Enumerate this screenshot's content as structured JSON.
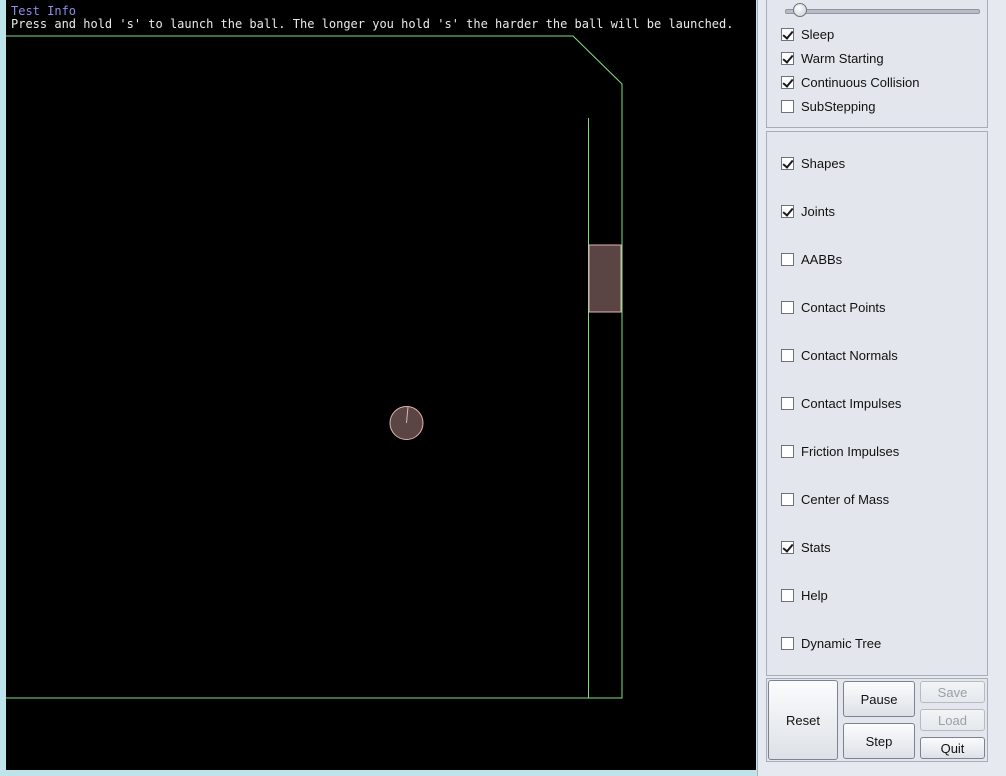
{
  "info": {
    "title": "Test Info",
    "text": "Press and hold 's' to launch the ball. The longer you hold 's' the harder the ball will be launched."
  },
  "colors": {
    "background": "#000000",
    "wall": "#80e080",
    "body_fill": "#5a4444",
    "body_stroke": "#e6b3b3"
  },
  "settings": {
    "slider_value": 0.04,
    "toggles": [
      {
        "label": "Sleep",
        "checked": true
      },
      {
        "label": "Warm Starting",
        "checked": true
      },
      {
        "label": "Continuous Collision",
        "checked": true
      },
      {
        "label": "SubStepping",
        "checked": false
      }
    ]
  },
  "draw": {
    "options": [
      {
        "label": "Shapes",
        "checked": true
      },
      {
        "label": "Joints",
        "checked": true
      },
      {
        "label": "AABBs",
        "checked": false
      },
      {
        "label": "Contact Points",
        "checked": false
      },
      {
        "label": "Contact Normals",
        "checked": false
      },
      {
        "label": "Contact Impulses",
        "checked": false
      },
      {
        "label": "Friction Impulses",
        "checked": false
      },
      {
        "label": "Center of Mass",
        "checked": false
      },
      {
        "label": "Stats",
        "checked": true
      },
      {
        "label": "Help",
        "checked": false
      },
      {
        "label": "Dynamic Tree",
        "checked": false
      }
    ]
  },
  "buttons": {
    "reset": "Reset",
    "pause": "Pause",
    "step": "Step",
    "save": "Save",
    "load": "Load",
    "quit": "Quit"
  }
}
